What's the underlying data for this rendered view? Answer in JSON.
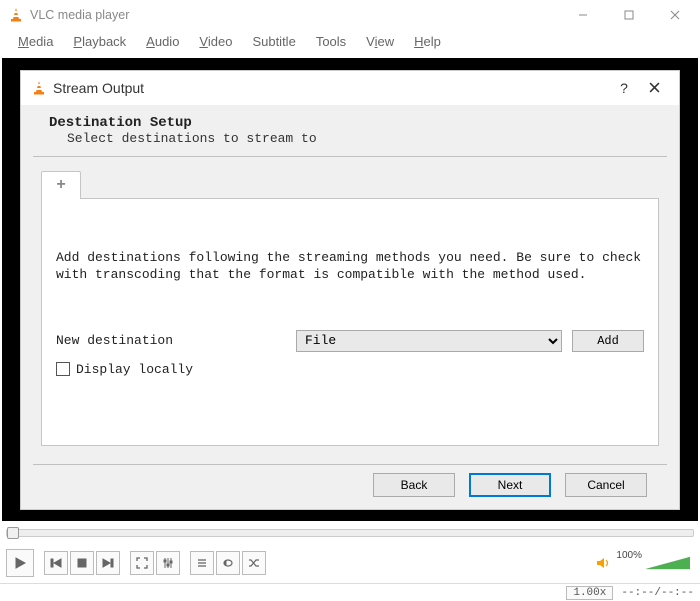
{
  "window": {
    "title": "VLC media player",
    "controls": {
      "min": "—",
      "max": "▢",
      "close": "✕"
    }
  },
  "menu": {
    "items": [
      {
        "label": "Media",
        "u": 0
      },
      {
        "label": "Playback",
        "u": 0
      },
      {
        "label": "Audio",
        "u": 0
      },
      {
        "label": "Video",
        "u": 0
      },
      {
        "label": "Subtitle",
        "u": -1
      },
      {
        "label": "Tools",
        "u": -1
      },
      {
        "label": "View",
        "u": 1
      },
      {
        "label": "Help",
        "u": 0
      }
    ]
  },
  "dialog": {
    "title": "Stream Output",
    "help": "?",
    "heading": "Destination Setup",
    "subheading": "Select destinations to stream to",
    "panel_desc": "Add destinations following the streaming methods you need. Be sure to check with transcoding that the format is compatible with the method used.",
    "new_dest_label": "New destination",
    "dest_selected": "File",
    "add_label": "Add",
    "display_locally_label": "Display locally",
    "display_locally_checked": false,
    "buttons": {
      "back": "Back",
      "next": "Next",
      "cancel": "Cancel"
    }
  },
  "transport": {
    "volume_pct": "100%",
    "speed": "1.00x",
    "time": "--:--/--:--"
  }
}
